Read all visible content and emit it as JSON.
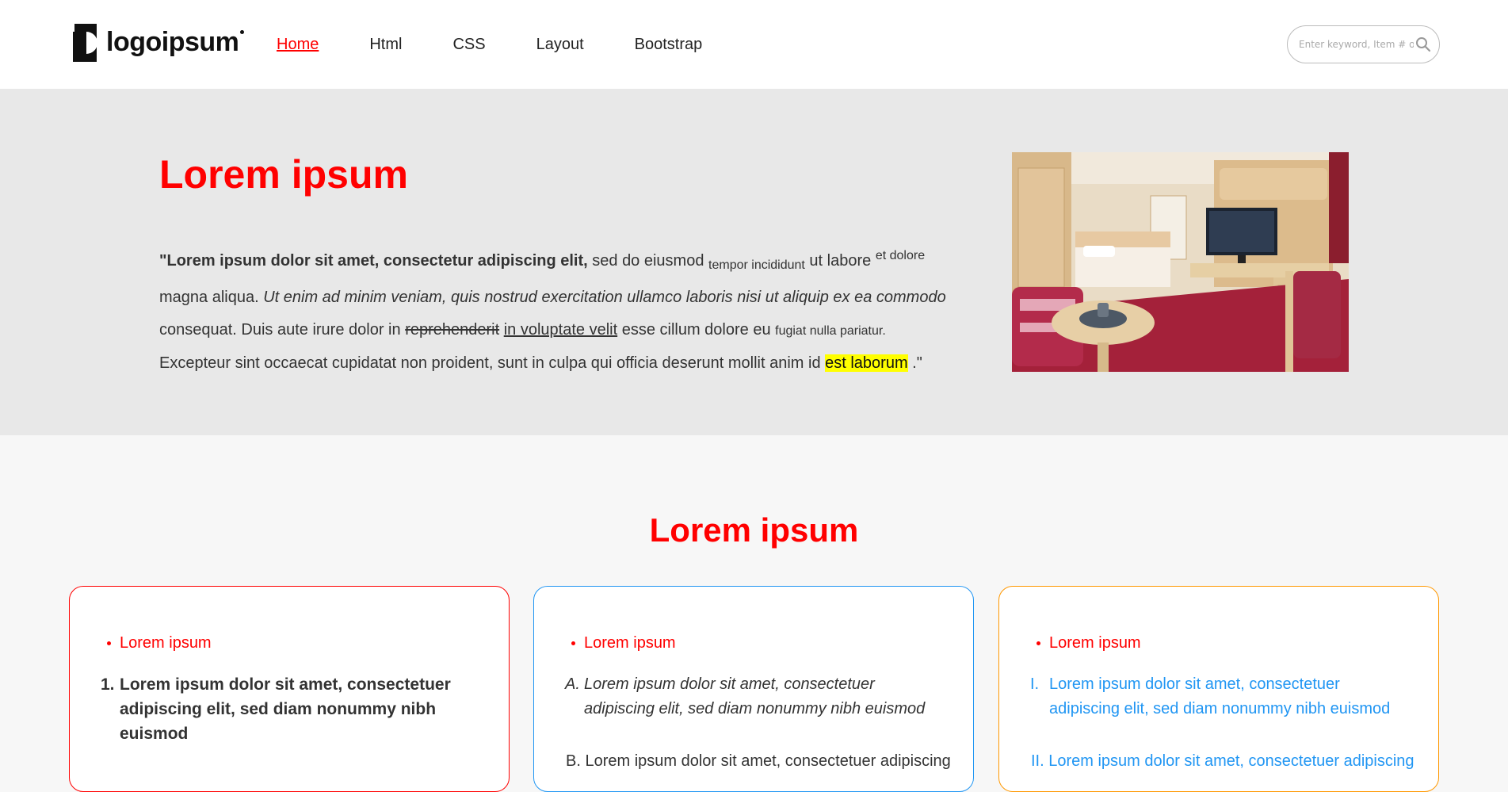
{
  "header": {
    "logo_text": "logoipsum",
    "nav": [
      {
        "label": "Home",
        "active": true
      },
      {
        "label": "Html"
      },
      {
        "label": "CSS"
      },
      {
        "label": "Layout"
      },
      {
        "label": "Bootstrap"
      }
    ],
    "search": {
      "placeholder": "Enter keyword, Item # o"
    }
  },
  "hero": {
    "title": "Lorem ipsum",
    "text": {
      "bold": "\"Lorem ipsum dolor sit amet, consectetur adipiscing elit,",
      "t1": " sed do eiusmod ",
      "sub": "tempor incididunt",
      "t2": " ut labore ",
      "sup": "et dolore",
      "t3": " magna aliqua. ",
      "italic": "Ut enim ad minim veniam, quis nostrud exercitation ullamco laboris nisi ut aliquip ex ea commodo",
      "t4": " consequat. Duis aute irure dolor in ",
      "strike": "reprehenderit",
      "t5": " ",
      "underline": "in voluptate velit",
      "t6": " esse cillum dolore eu ",
      "small": "fugiat nulla pariatur.",
      "t7": " Excepteur sint occaecat cupidatat non proident, sunt in culpa qui officia deserunt mollit anim id ",
      "highlight": "est laborum",
      "t8": " .\""
    },
    "image": {
      "subject": "hotel-room-photo"
    }
  },
  "section": {
    "title": "Lorem ipsum",
    "cards": [
      {
        "bullet": "Lorem ipsum",
        "marker": "1.",
        "item": "Lorem ipsum dolor sit amet, consectetuer adipiscing elit, sed diam nonummy nibh euismod",
        "next": ""
      },
      {
        "bullet": "Lorem ipsum",
        "marker": "A.",
        "item": "Lorem ipsum dolor sit amet, consectetuer adipiscing elit, sed diam nonummy nibh euismod",
        "next": "B. Lorem ipsum dolor sit amet, consectetuer adipiscing"
      },
      {
        "bullet": "Lorem ipsum",
        "marker": "I.",
        "item": "Lorem ipsum dolor sit amet, consectetuer adipiscing elit, sed diam nonummy nibh euismod",
        "next": "II. Lorem ipsum dolor sit amet, consectetuer adipiscing"
      }
    ]
  },
  "colors": {
    "accent_red": "#ff0000",
    "accent_blue": "#2196f3",
    "accent_orange": "#ff9800",
    "hero_bg": "#e8e8e8",
    "highlight": "#ffff00"
  }
}
